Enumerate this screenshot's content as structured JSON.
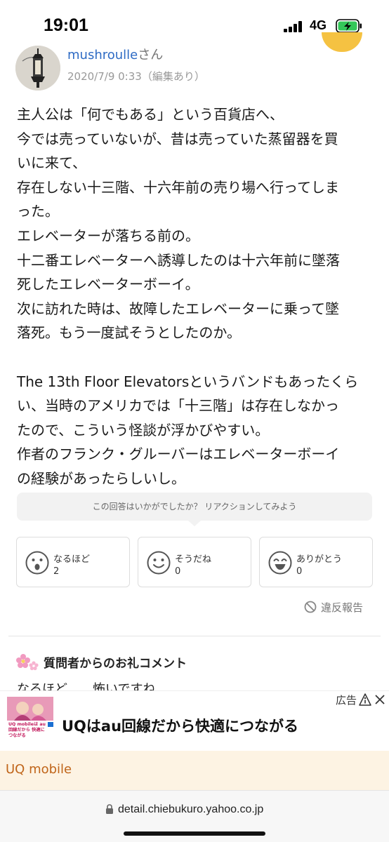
{
  "status": {
    "time": "19:01",
    "network": "4G",
    "icons": [
      "signal-icon",
      "battery-charging-icon"
    ]
  },
  "answer": {
    "username": "mushroulle",
    "honorific": "さん",
    "date": "2020/7/9 0:33（編集あり）",
    "lines": [
      "主人公は「何でもある」という百貨店へ、",
      "今では売っていないが、昔は売っていた蒸留器を買",
      "いに来て、",
      "存在しない十三階、十六年前の売り場へ行ってしま",
      "った。",
      "エレベーターが落ちる前の。",
      "十二番エレベーターへ誘導したのは十六年前に墜落",
      "死したエレベーターボーイ。",
      "次に訪れた時は、故障したエレベーターに乗って墜",
      "落死。もう一度試そうとしたのか。",
      "",
      "The 13th Floor Elevatorsというバンドもあったくら",
      "い、当時のアメリカでは「十三階」は存在しなかっ",
      "たので、こういう怪談が浮かびやすい。",
      "作者のフランク・グルーバーはエレベーターボーイ",
      "の経験があったらしいし。"
    ]
  },
  "reaction_prompt": "この回答はいかがでしたか？ リアクションしてみよう",
  "reactions": [
    {
      "label": "なるほど",
      "count": "2",
      "icon": "surprised-face-icon"
    },
    {
      "label": "そうだね",
      "count": "0",
      "icon": "smile-face-icon"
    },
    {
      "label": "ありがとう",
      "count": "0",
      "icon": "grin-face-icon"
    }
  ],
  "report_label": "違反報告",
  "thanks": {
    "title": "質問者からのお礼コメント",
    "text": "なるほど……怖いですね"
  },
  "ad": {
    "label": "広告",
    "headline": "UQはau回線だから快適につながる",
    "advertiser": "UQ mobile",
    "thumb_text": "UQ mobileは au回線だから 快適につながる"
  },
  "browser": {
    "url": "detail.chiebukuro.yahoo.co.jp"
  },
  "colors": {
    "link": "#2e6bc4",
    "advertiser": "#c0651a",
    "ad_bg": "#fdf3e3",
    "badge": "#f5c242"
  }
}
